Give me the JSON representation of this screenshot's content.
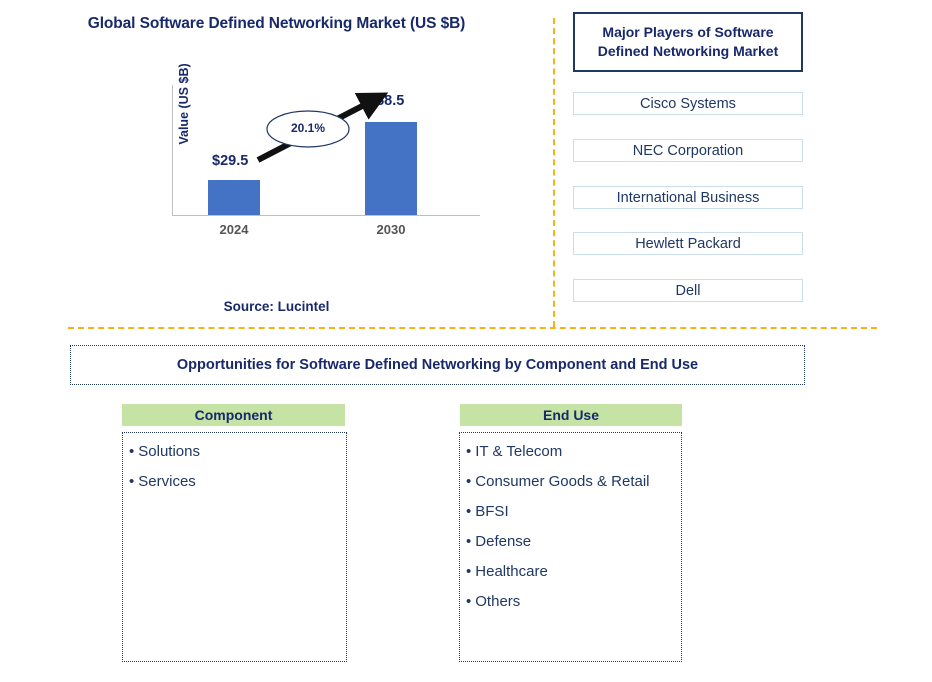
{
  "chart_panel": {
    "title": "Global Software Defined Networking Market (US $B)",
    "source": "Source: Lucintel"
  },
  "chart_data": {
    "type": "bar",
    "title": "Global Software Defined Networking Market (US $B)",
    "categories": [
      "2024",
      "2030"
    ],
    "values": [
      29.5,
      88.5
    ],
    "value_labels": [
      "$29.5",
      "$88.5"
    ],
    "xlabel": "",
    "ylabel": "Value (US $B)",
    "ylim": [
      0,
      100
    ],
    "grid": false,
    "legend": "none",
    "bar_color": "#4472C4",
    "annotations": [
      {
        "text": "20.1%",
        "type": "cagr-ellipse",
        "from": "2024",
        "to": "2030"
      }
    ]
  },
  "players": {
    "header": "Major Players of Software Defined Networking Market",
    "items": [
      "Cisco Systems",
      "NEC Corporation",
      "International Business",
      "Hewlett Packard",
      "Dell"
    ]
  },
  "opportunities": {
    "title": "Opportunities for Software Defined Networking by Component and End Use",
    "columns": [
      {
        "header": "Component",
        "items": [
          "Solutions",
          "Services"
        ]
      },
      {
        "header": "End Use",
        "items": [
          "IT & Telecom",
          "Consumer Goods & Retail",
          "BFSI",
          "Defense",
          "Healthcare",
          "Others"
        ]
      }
    ]
  },
  "theme": {
    "accent_orange": "#F5B316",
    "navy": "#1F3864",
    "bar_blue": "#4472C4",
    "header_green": "#C5E3A5"
  }
}
